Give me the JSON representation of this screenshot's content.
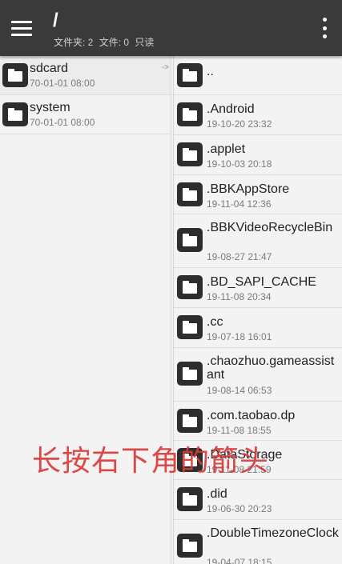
{
  "appbar": {
    "title": "/",
    "folders_label": "文件夹: 2",
    "files_label": "文件: 0",
    "readonly_label": "只读"
  },
  "left_pane": {
    "arrow_hint": "->",
    "items": [
      {
        "name": "sdcard",
        "date": "70-01-01 08:00"
      },
      {
        "name": "system",
        "date": "70-01-01 08:00"
      }
    ]
  },
  "right_pane": {
    "items": [
      {
        "name": "..",
        "date": ""
      },
      {
        "name": ".Android",
        "date": "19-10-20 23:32"
      },
      {
        "name": ".applet",
        "date": "19-10-03 20:18"
      },
      {
        "name": ".BBKAppStore",
        "date": "19-11-04 12:36"
      },
      {
        "name": ".BBKVideoRecycleBin",
        "date": "19-08-27 21:47"
      },
      {
        "name": ".BD_SAPI_CACHE",
        "date": "19-11-08 20:34"
      },
      {
        "name": ".cc",
        "date": "19-07-18 16:01"
      },
      {
        "name": ".chaozhuo.gameassistant",
        "date": "19-08-14 06:53"
      },
      {
        "name": ".com.taobao.dp",
        "date": "19-11-08 18:55"
      },
      {
        "name": ".DataStorage",
        "date": "19-11-08 21:59"
      },
      {
        "name": ".did",
        "date": "19-06-30 20:23"
      },
      {
        "name": ".DoubleTimezoneClock",
        "date": "19-04-07 18:15"
      }
    ]
  },
  "overlay_text": "长按右下角的箭头"
}
